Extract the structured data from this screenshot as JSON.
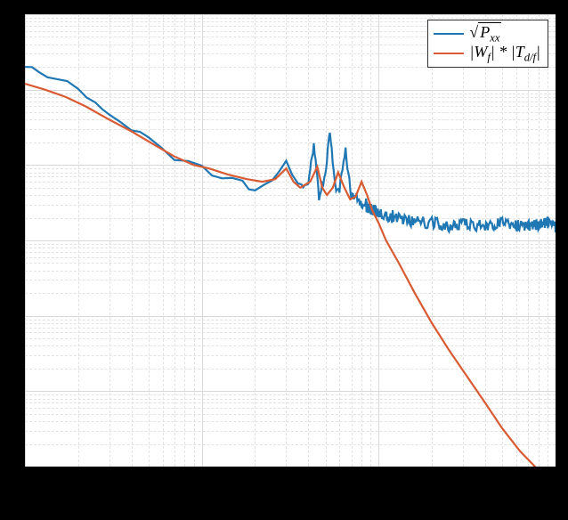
{
  "chart_data": {
    "type": "line",
    "xscale": "log",
    "yscale": "log",
    "xlim": [
      0.1,
      100
    ],
    "ylim": [
      1e-15,
      1e-09
    ],
    "series": [
      {
        "name": "sqrt(Pxx)",
        "label_tex": "\\sqrt{P_{xx}}",
        "color": "#1f77b4",
        "x": [
          0.1,
          0.12,
          0.15,
          0.2,
          0.25,
          0.3,
          0.4,
          0.5,
          0.7,
          1,
          1.3,
          1.7,
          2,
          2.5,
          3,
          3.5,
          4,
          4.3,
          4.6,
          5,
          5.3,
          5.7,
          6,
          6.5,
          7,
          7.5,
          8,
          8.5,
          9,
          9.5,
          10,
          12,
          15,
          20,
          25,
          30,
          40,
          50,
          60,
          70,
          80,
          90,
          100
        ],
        "y": [
          2e-10,
          1.7e-10,
          1.4e-10,
          1e-10,
          7e-11,
          4.5e-11,
          3e-11,
          2.2e-11,
          1.2e-11,
          9e-12,
          7e-12,
          5.5e-12,
          5e-12,
          5.5e-12,
          1.2e-11,
          5e-12,
          6e-12,
          1.8e-11,
          4e-12,
          7e-12,
          3e-11,
          4.5e-12,
          5e-12,
          1.5e-11,
          4e-12,
          3.5e-12,
          3e-12,
          2.8e-12,
          2.6e-12,
          2.5e-12,
          2.3e-12,
          2e-12,
          1.8e-12,
          1.7e-12,
          1.6e-12,
          1.6e-12,
          1.6e-12,
          1.7e-12,
          1.6e-12,
          1.6e-12,
          1.6e-12,
          1.7e-12,
          1.6e-12
        ]
      },
      {
        "name": "|Wf|*|Td/f|",
        "label_tex": "|W_f| * |T_{d/f}|",
        "color": "#d95b33",
        "x": [
          0.1,
          0.13,
          0.17,
          0.22,
          0.3,
          0.4,
          0.55,
          0.7,
          0.9,
          1.1,
          1.4,
          1.8,
          2.2,
          2.6,
          3,
          3.3,
          3.6,
          4.1,
          4.5,
          4.8,
          5.1,
          5.5,
          5.9,
          6.4,
          6.9,
          7.4,
          8,
          8.6,
          9.2,
          10,
          11,
          13,
          16,
          20,
          25,
          32,
          40,
          50,
          63,
          80,
          100
        ],
        "y": [
          1.2e-10,
          1e-10,
          8e-11,
          6e-11,
          4e-11,
          2.8e-11,
          1.8e-11,
          1.3e-11,
          1e-11,
          9e-12,
          7.5e-12,
          6.5e-12,
          6e-12,
          6.5e-12,
          9e-12,
          6e-12,
          5e-12,
          6e-12,
          9.5e-12,
          5e-12,
          4e-12,
          5e-12,
          8e-12,
          5e-12,
          3.5e-12,
          3.8e-12,
          6e-12,
          4e-12,
          2.5e-12,
          1.7e-12,
          1e-12,
          5e-13,
          2e-13,
          8e-14,
          3.5e-14,
          1.5e-14,
          7e-15,
          3.2e-15,
          1.6e-15,
          9e-16,
          5e-16
        ]
      }
    ]
  },
  "legend": {
    "entries": [
      {
        "color": "#1f77b4",
        "html": "&radic;<span class='sqrt'>P<sub>xx</sub></span>"
      },
      {
        "color": "#d95b33",
        "html": "|<i>W<sub>f</sub></i>| * |<i>T<sub>d/f</sub></i>|"
      }
    ]
  }
}
